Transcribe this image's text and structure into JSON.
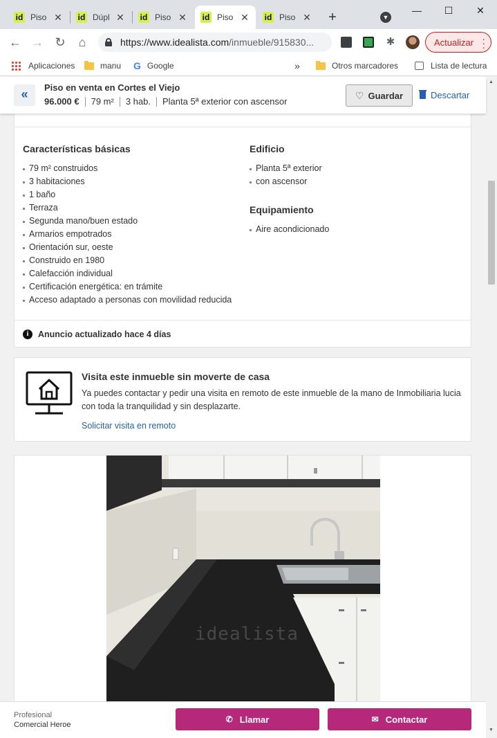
{
  "browser": {
    "tabs": [
      {
        "label": "Piso",
        "active": false
      },
      {
        "label": "Dúpl",
        "active": false
      },
      {
        "label": "Piso",
        "active": false
      },
      {
        "label": "Piso",
        "active": true
      },
      {
        "label": "Piso",
        "active": false
      }
    ],
    "favicon_text": "id",
    "new_tab_label": "+",
    "url_domain": "https://www.idealista.com",
    "url_path": "/inmueble/915830...",
    "update_label": "Actualizar",
    "bookmarks": {
      "apps": "Aplicaciones",
      "manu": "manu",
      "google": "Google",
      "more": "»",
      "others": "Otros marcadores",
      "reading_list": "Lista de lectura"
    }
  },
  "header": {
    "back_label": "«",
    "title": "Piso en venta en Cortes el Viejo",
    "price": "96.000 €",
    "size": "79 m²",
    "rooms": "3 hab.",
    "floor": "Planta 5ª exterior con ascensor",
    "save_label": "Guardar",
    "discard_label": "Descartar"
  },
  "features": {
    "basic_title": "Características básicas",
    "basic_items": [
      "79 m² construidos",
      "3 habitaciones",
      "1 baño",
      "Terraza",
      "Segunda mano/buen estado",
      "Armarios empotrados",
      "Orientación sur, oeste",
      "Construido en 1980",
      "Calefacción individual",
      "Certificación energética: en trámite",
      "Acceso adaptado a personas con movilidad reducida"
    ],
    "building_title": "Edificio",
    "building_items": [
      "Planta 5ª exterior",
      "con ascensor"
    ],
    "equipment_title": "Equipamiento",
    "equipment_items": [
      "Aire acondicionado"
    ],
    "updated_text": "Anuncio actualizado hace 4 días"
  },
  "visit": {
    "title": "Visita este inmueble sin moverte de casa",
    "text": "Ya puedes contactar y pedir una visita en remoto de este inmueble de la mano de Inmobiliaria lucia con toda la tranquilidad y sin desplazarte.",
    "link": "Solicitar visita en remoto"
  },
  "photo": {
    "watermark": "idealista"
  },
  "contact": {
    "profile_type": "Profesional",
    "profile_name": "Comercial Heroe",
    "call_label": "Llamar",
    "contact_label": "Contactar"
  },
  "colors": {
    "brand_blue": "#2460b6",
    "cta_magenta": "#b5287a",
    "update_red": "#c5221f"
  }
}
